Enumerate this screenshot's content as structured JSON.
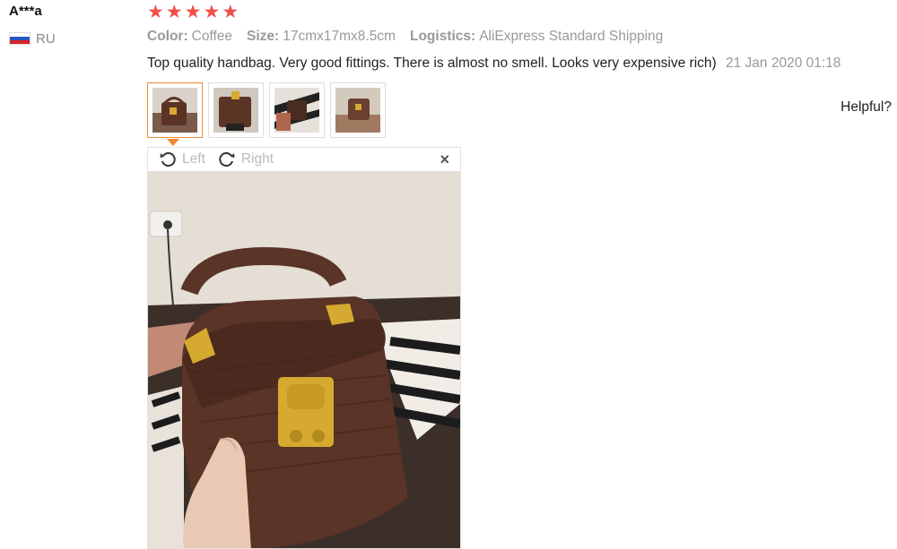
{
  "user": {
    "name": "A***a",
    "country": "RU",
    "flag_colors": [
      "#ffffff",
      "#2b55c8",
      "#d8232a"
    ]
  },
  "rating": {
    "stars": 5,
    "max": 5,
    "color": "#f24f4a"
  },
  "attributes": [
    {
      "label": "Color:",
      "value": "Coffee"
    },
    {
      "label": "Size:",
      "value": "17cmx17mx8.5cm"
    },
    {
      "label": "Logistics:",
      "value": "AliExpress Standard Shipping"
    }
  ],
  "review": {
    "text": "Top quality handbag. Very good fittings. There is almost no smell. Looks very expensive rich)",
    "date": "21 Jan 2020 01:18"
  },
  "thumbnails": [
    {
      "icon": "handbag-photo-thumbnail",
      "active": true
    },
    {
      "icon": "handbag-photo-thumbnail",
      "active": false
    },
    {
      "icon": "handbag-photo-thumbnail",
      "active": false
    },
    {
      "icon": "handbag-photo-thumbnail",
      "active": false
    }
  ],
  "helpful": "Helpful?",
  "viewer": {
    "rotate_left": "Left",
    "rotate_right": "Right",
    "close": "×"
  },
  "colors": {
    "accent": "#f08a33",
    "muted": "#999999"
  }
}
